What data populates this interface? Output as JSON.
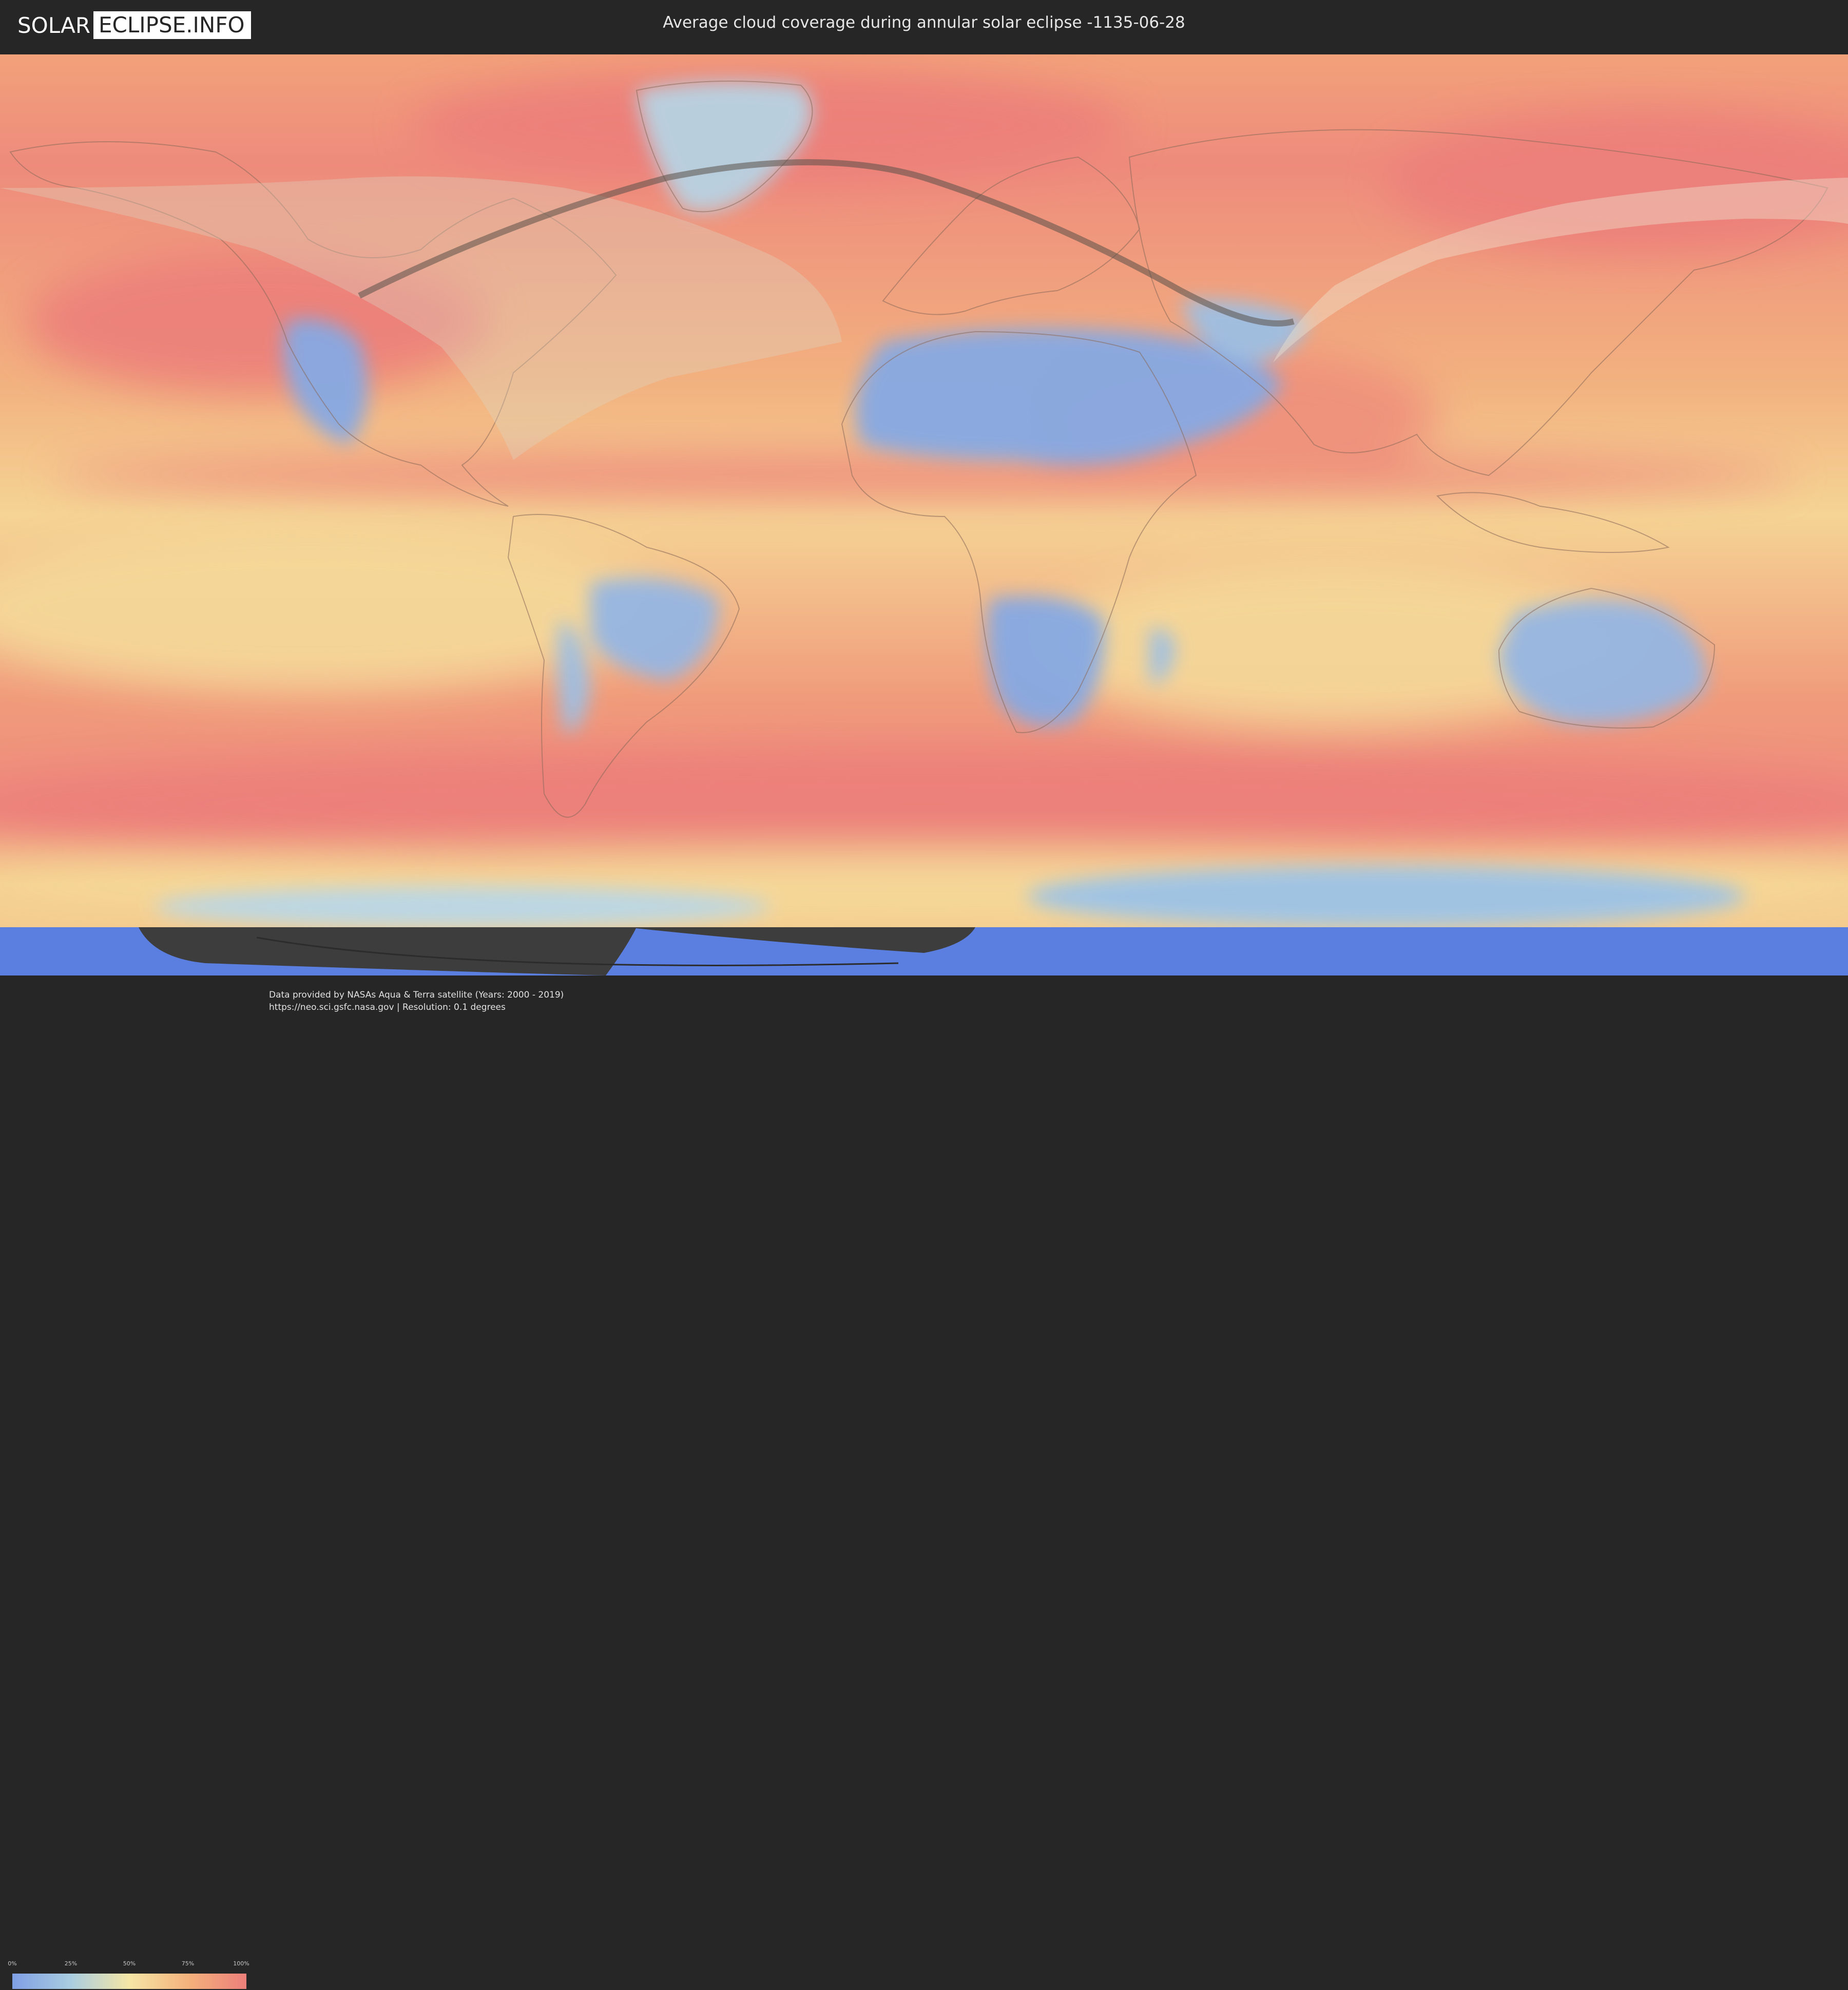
{
  "header": {
    "logo_part1": "SOLAR",
    "logo_part2": "ECLIPSE.INFO",
    "title": "Average cloud coverage during annular solar eclipse -1135-06-28"
  },
  "legend": {
    "ticks": [
      "0%",
      "25%",
      "50%",
      "75%",
      "100%"
    ],
    "colors": [
      "#7f9fe4",
      "#a9cde0",
      "#f5e6a6",
      "#f4b27c",
      "#ec7f7a"
    ]
  },
  "footer": {
    "credit_line1": "Data provided by NASAs Aqua & Terra satellite (Years: 2000 - 2019)",
    "credit_line2": "https://neo.sci.gsfc.nasa.gov | Resolution: 0.1 degrees"
  },
  "map": {
    "ocean_cloud_color": "#ef8b7e",
    "clear_color": "#86a9e3",
    "antarctic_color": "#5b7fe0"
  }
}
